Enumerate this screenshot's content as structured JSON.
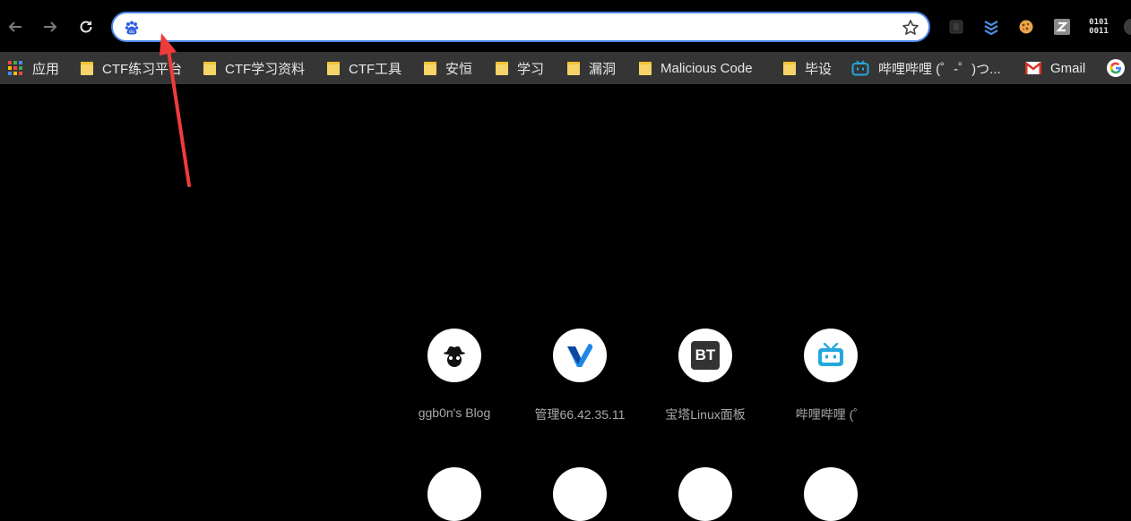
{
  "toolbar": {
    "back_icon": "back-arrow-icon",
    "forward_icon": "forward-arrow-icon",
    "reload_icon": "reload-icon",
    "omnibox": {
      "value": "",
      "placeholder": "",
      "search_engine_icon": "baidu-paw-icon",
      "bookmark_star_icon": "star-icon"
    },
    "extensions": [
      {
        "icon": "extension-box-icon"
      },
      {
        "icon": "layers-chevron-icon"
      },
      {
        "icon": "cookie-icon"
      },
      {
        "icon": "z-square-icon"
      },
      {
        "icon": "binary-icon",
        "text_top": "0101",
        "text_bottom": "0011"
      }
    ]
  },
  "bookmarks": [
    {
      "label": "应用",
      "icon": "apps-grid-icon"
    },
    {
      "label": "CTF练习平台",
      "icon": "folder-icon"
    },
    {
      "label": "CTF学习资料",
      "icon": "folder-icon"
    },
    {
      "label": "CTF工具",
      "icon": "folder-icon"
    },
    {
      "label": "安恒",
      "icon": "folder-icon"
    },
    {
      "label": "学习",
      "icon": "folder-icon"
    },
    {
      "label": "漏洞",
      "icon": "folder-icon"
    },
    {
      "label": "Malicious Code",
      "icon": "folder-icon"
    },
    {
      "label": "毕设",
      "icon": "folder-icon"
    },
    {
      "label": "哔哩哔哩 (゜-゜)つ...",
      "icon": "bilibili-icon"
    },
    {
      "label": "Gmail",
      "icon": "gmail-icon"
    },
    {
      "label": "",
      "icon": "google-icon"
    }
  ],
  "shortcuts": [
    {
      "label": "ggb0n's Blog",
      "icon": "spy-hat-icon"
    },
    {
      "label": "管理66.42.35.11",
      "icon": "v-logo-icon"
    },
    {
      "label": "宝塔Linux面板",
      "icon": "bt-logo-icon",
      "icon_text": "BT"
    },
    {
      "label": "哔哩哔哩 (゜",
      "icon": "bilibili-tv-icon"
    }
  ],
  "annotation": {
    "type": "red-arrow",
    "color": "#f03b3b"
  },
  "colors": {
    "accent": "#4a86e8",
    "bookmark_bar": "#353535",
    "page_bg": "#000000"
  }
}
